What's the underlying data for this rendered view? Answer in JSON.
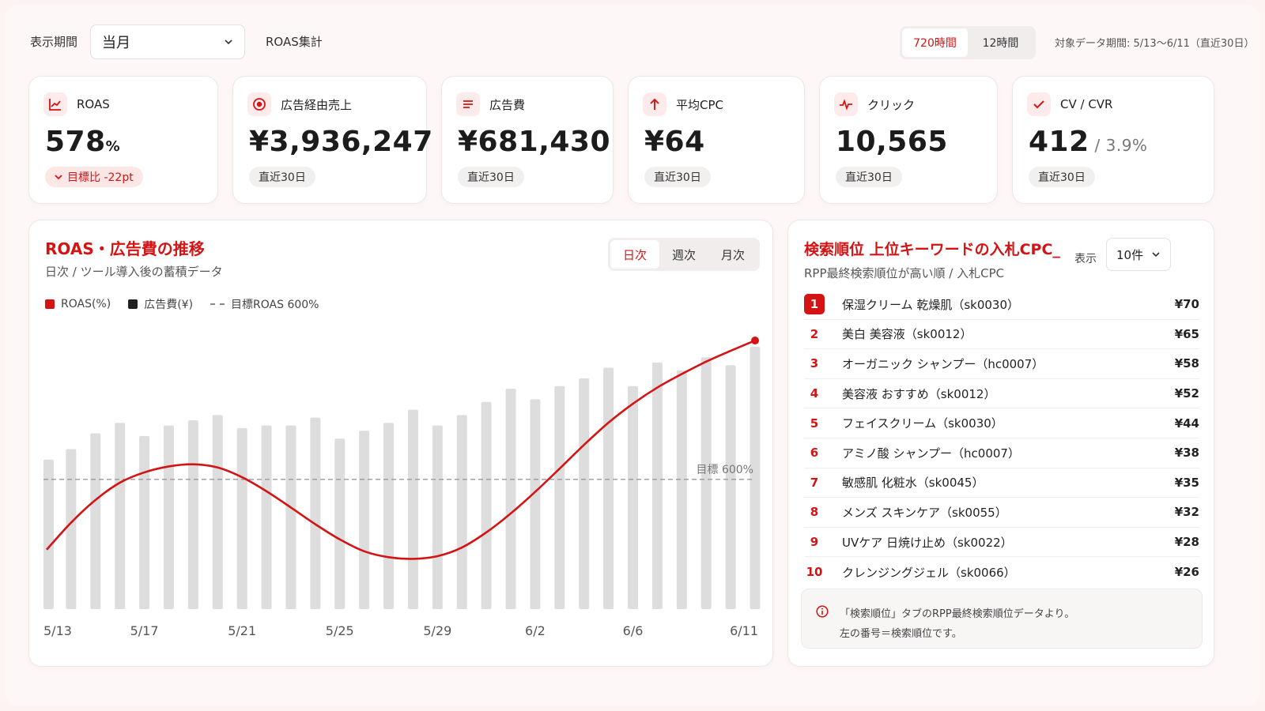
{
  "header": {
    "period_label": "表示期間",
    "period_value": "当月",
    "aggregation_label": "ROAS集計",
    "hour_options": [
      "720時間",
      "12時間"
    ],
    "hour_active": 0,
    "data_range": "対象データ期間: 5/13〜6/11（直近30日）"
  },
  "kpis": [
    {
      "icon": "line-chart-icon",
      "label": "ROAS",
      "value": "578",
      "unit": "%",
      "chip": "目標比 -22pt",
      "chip_kind": "down"
    },
    {
      "icon": "target-icon",
      "label": "広告経由売上",
      "value": "¥3,936,247",
      "chip": "直近30日"
    },
    {
      "icon": "list-icon",
      "label": "広告費",
      "value": "¥681,430",
      "chip": "直近30日"
    },
    {
      "icon": "arrow-up-icon",
      "label": "平均CPC",
      "value": "¥64",
      "chip": "直近30日"
    },
    {
      "icon": "pulse-icon",
      "label": "クリック",
      "value": "10,565",
      "chip": "直近30日"
    },
    {
      "icon": "check-icon",
      "label": "CV / CVR",
      "value": "412",
      "sub": " / 3.9%",
      "chip": "直近30日"
    }
  ],
  "chart_section": {
    "title": "ROAS・広告費の推移",
    "subtitle": "日次 / ツール導入後の蓄積データ",
    "tabs": [
      "日次",
      "週次",
      "月次"
    ],
    "tab_active": 0,
    "legend": [
      "ROAS(%)",
      "広告費(¥)",
      "目標ROAS 600%"
    ],
    "target_label": "目標 600%"
  },
  "chart_data": {
    "type": "bar",
    "x": [
      "5/13",
      "5/14",
      "5/15",
      "5/16",
      "5/17",
      "5/18",
      "5/19",
      "5/20",
      "5/21",
      "5/22",
      "5/23",
      "5/24",
      "5/25",
      "5/26",
      "5/27",
      "5/28",
      "5/29",
      "5/30",
      "5/31",
      "6/1",
      "6/2",
      "6/3",
      "6/4",
      "6/5",
      "6/6",
      "6/7",
      "6/8",
      "6/9",
      "6/10",
      "6/11"
    ],
    "x_tick_labels": [
      "5/13",
      "5/17",
      "5/21",
      "5/25",
      "5/29",
      "6/2",
      "6/6",
      "6/11"
    ],
    "series": [
      {
        "name": "広告費(¥)",
        "kind": "bar",
        "color": "#dddddd",
        "values": [
          0.57,
          0.61,
          0.67,
          0.71,
          0.66,
          0.7,
          0.72,
          0.74,
          0.69,
          0.7,
          0.7,
          0.73,
          0.65,
          0.68,
          0.71,
          0.76,
          0.7,
          0.74,
          0.79,
          0.84,
          0.8,
          0.85,
          0.88,
          0.92,
          0.85,
          0.94,
          0.91,
          0.96,
          0.93,
          1.0
        ]
      },
      {
        "name": "ROAS(%)",
        "kind": "line",
        "color": "#d41414",
        "values": [
          470,
          520,
          562,
          594,
          613,
          624,
          628,
          622,
          604,
          578,
          548,
          517,
          489,
          467,
          456,
          453,
          458,
          474,
          502,
          537,
          577,
          620,
          664,
          705,
          740,
          770,
          795,
          818,
          838,
          857
        ]
      }
    ],
    "ylim_roas": [
      360,
      860
    ],
    "target_roas": 600
  },
  "keywords": {
    "title": "検索順位 上位キーワードの入札CPC_",
    "subtitle": "RPP最終検索順位が高い順 / 入札CPC",
    "show_label": "表示",
    "count_value": "10件",
    "rows": [
      {
        "rank": "1",
        "name": "保湿クリーム 乾燥肌（sk0030）",
        "cpc": "¥70"
      },
      {
        "rank": "2",
        "name": "美白 美容液（sk0012）",
        "cpc": "¥65"
      },
      {
        "rank": "3",
        "name": "オーガニック シャンプー（hc0007）",
        "cpc": "¥58"
      },
      {
        "rank": "4",
        "name": "美容液 おすすめ（sk0012）",
        "cpc": "¥52"
      },
      {
        "rank": "5",
        "name": "フェイスクリーム（sk0030）",
        "cpc": "¥44"
      },
      {
        "rank": "6",
        "name": "アミノ酸 シャンプー（hc0007）",
        "cpc": "¥38"
      },
      {
        "rank": "7",
        "name": "敏感肌 化粧水（sk0045）",
        "cpc": "¥35"
      },
      {
        "rank": "8",
        "name": "メンズ スキンケア（sk0055）",
        "cpc": "¥32"
      },
      {
        "rank": "9",
        "name": "UVケア 日焼け止め（sk0022）",
        "cpc": "¥28"
      },
      {
        "rank": "10",
        "name": "クレンジングジェル（sk0066）",
        "cpc": "¥26"
      }
    ],
    "note_line1": "「検索順位」タブのRPP最終検索順位データより。",
    "note_line2": "左の番号＝検索順位です。"
  },
  "colors": {
    "accent": "#d41414",
    "bar": "#dddddd"
  }
}
